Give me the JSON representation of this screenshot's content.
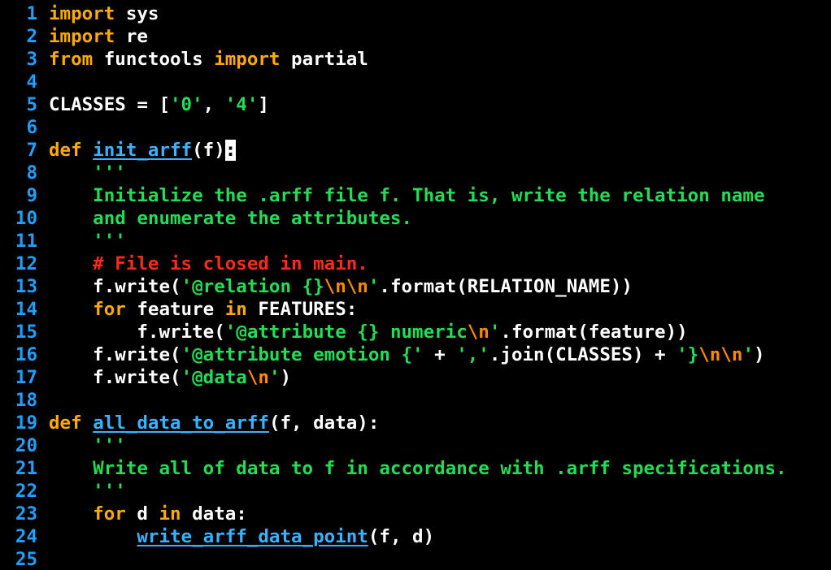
{
  "editor": {
    "lines": [
      {
        "n": "1",
        "tokens": [
          {
            "t": "import",
            "c": "kw"
          },
          {
            "t": " sys",
            "c": "plain"
          }
        ]
      },
      {
        "n": "2",
        "tokens": [
          {
            "t": "import",
            "c": "kw"
          },
          {
            "t": " re",
            "c": "plain"
          }
        ]
      },
      {
        "n": "3",
        "tokens": [
          {
            "t": "from",
            "c": "kw"
          },
          {
            "t": " functools ",
            "c": "plain"
          },
          {
            "t": "import",
            "c": "kw"
          },
          {
            "t": " partial",
            "c": "plain"
          }
        ]
      },
      {
        "n": "4",
        "tokens": []
      },
      {
        "n": "5",
        "tokens": [
          {
            "t": "CLASSES = [",
            "c": "plain"
          },
          {
            "t": "'0'",
            "c": "str"
          },
          {
            "t": ", ",
            "c": "plain"
          },
          {
            "t": "'4'",
            "c": "str"
          },
          {
            "t": "]",
            "c": "plain"
          }
        ]
      },
      {
        "n": "6",
        "tokens": []
      },
      {
        "n": "7",
        "tokens": [
          {
            "t": "def",
            "c": "kw"
          },
          {
            "t": " ",
            "c": "plain"
          },
          {
            "t": "init_arff",
            "c": "fn"
          },
          {
            "t": "(f)",
            "c": "plain"
          },
          {
            "t": ":",
            "c": "cursor"
          }
        ]
      },
      {
        "n": "8",
        "tokens": [
          {
            "t": "    '''",
            "c": "str"
          }
        ]
      },
      {
        "n": "9",
        "tokens": [
          {
            "t": "    Initialize the .arff file f. That is, write the relation name",
            "c": "str"
          }
        ]
      },
      {
        "n": "10",
        "tokens": [
          {
            "t": "    and enumerate the attributes.",
            "c": "str"
          }
        ]
      },
      {
        "n": "11",
        "tokens": [
          {
            "t": "    '''",
            "c": "str"
          }
        ]
      },
      {
        "n": "12",
        "tokens": [
          {
            "t": "    # File is closed in main.",
            "c": "cmt"
          }
        ]
      },
      {
        "n": "13",
        "tokens": [
          {
            "t": "    f.write(",
            "c": "plain"
          },
          {
            "t": "'@relation {}",
            "c": "str"
          },
          {
            "t": "\\n\\n",
            "c": "esc"
          },
          {
            "t": "'",
            "c": "str"
          },
          {
            "t": ".format(RELATION_NAME))",
            "c": "plain"
          }
        ]
      },
      {
        "n": "14",
        "tokens": [
          {
            "t": "    ",
            "c": "plain"
          },
          {
            "t": "for",
            "c": "kw"
          },
          {
            "t": " feature ",
            "c": "plain"
          },
          {
            "t": "in",
            "c": "kw"
          },
          {
            "t": " FEATURES:",
            "c": "plain"
          }
        ]
      },
      {
        "n": "15",
        "tokens": [
          {
            "t": "        f.write(",
            "c": "plain"
          },
          {
            "t": "'@attribute {} numeric",
            "c": "str"
          },
          {
            "t": "\\n",
            "c": "esc"
          },
          {
            "t": "'",
            "c": "str"
          },
          {
            "t": ".format(feature))",
            "c": "plain"
          }
        ]
      },
      {
        "n": "16",
        "tokens": [
          {
            "t": "    f.write(",
            "c": "plain"
          },
          {
            "t": "'@attribute emotion {'",
            "c": "str"
          },
          {
            "t": " + ",
            "c": "plain"
          },
          {
            "t": "','",
            "c": "str"
          },
          {
            "t": ".join(CLASSES) + ",
            "c": "plain"
          },
          {
            "t": "'}",
            "c": "str"
          },
          {
            "t": "\\n\\n",
            "c": "esc"
          },
          {
            "t": "'",
            "c": "str"
          },
          {
            "t": ")",
            "c": "plain"
          }
        ]
      },
      {
        "n": "17",
        "tokens": [
          {
            "t": "    f.write(",
            "c": "plain"
          },
          {
            "t": "'@data",
            "c": "str"
          },
          {
            "t": "\\n",
            "c": "esc"
          },
          {
            "t": "'",
            "c": "str"
          },
          {
            "t": ")",
            "c": "plain"
          }
        ]
      },
      {
        "n": "18",
        "tokens": []
      },
      {
        "n": "19",
        "tokens": [
          {
            "t": "def",
            "c": "kw"
          },
          {
            "t": " ",
            "c": "plain"
          },
          {
            "t": "all_data_to_arff",
            "c": "fn"
          },
          {
            "t": "(f, data):",
            "c": "plain"
          }
        ]
      },
      {
        "n": "20",
        "tokens": [
          {
            "t": "    '''",
            "c": "str"
          }
        ]
      },
      {
        "n": "21",
        "tokens": [
          {
            "t": "    Write all of data to f in accordance with .arff specifications.",
            "c": "str"
          }
        ]
      },
      {
        "n": "22",
        "tokens": [
          {
            "t": "    '''",
            "c": "str"
          }
        ]
      },
      {
        "n": "23",
        "tokens": [
          {
            "t": "    ",
            "c": "plain"
          },
          {
            "t": "for",
            "c": "kw"
          },
          {
            "t": " d ",
            "c": "plain"
          },
          {
            "t": "in",
            "c": "kw"
          },
          {
            "t": " data:",
            "c": "plain"
          }
        ]
      },
      {
        "n": "24",
        "tokens": [
          {
            "t": "        ",
            "c": "plain"
          },
          {
            "t": "write_arff_data_point",
            "c": "call"
          },
          {
            "t": "(f, d)",
            "c": "plain"
          }
        ]
      },
      {
        "n": "25",
        "tokens": []
      }
    ]
  },
  "colors": {
    "background": "#000000",
    "line_number": "#1fa0ff",
    "keyword": "#ffaa00",
    "function": "#3ab2ff",
    "string": "#22dd55",
    "escape": "#ff8800",
    "comment": "#ff2a1a",
    "text": "#ffffff"
  }
}
